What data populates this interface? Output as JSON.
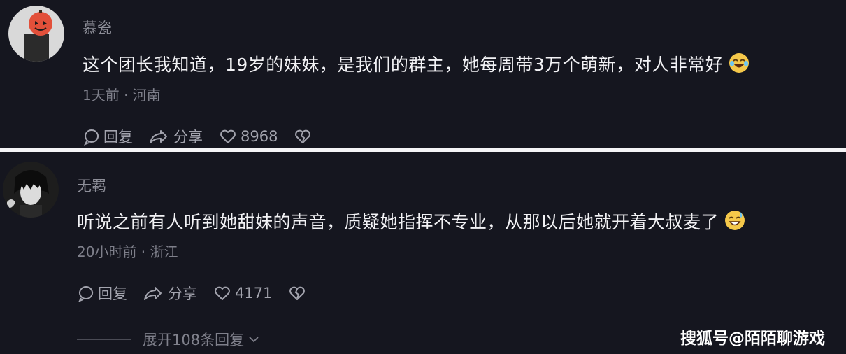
{
  "comments": [
    {
      "username": "慕瓷",
      "text": "这个团长我知道，19岁的妹妹，是我们的群主，她每周带3万个萌新，对人非常好",
      "emoji": "laughing-tears-emoji",
      "meta": "1天前 · 河南",
      "reply_label": "回复",
      "share_label": "分享",
      "likes": "8968"
    },
    {
      "username": "无羁",
      "text": "听说之前有人听到她甜妹的声音，质疑她指挥不专业，从那以后她就开着大叔麦了",
      "emoji": "sweat-smile-emoji",
      "meta": "20小时前 · 浙江",
      "reply_label": "回复",
      "share_label": "分享",
      "likes": "4171"
    }
  ],
  "expand_replies": "展开108条回复",
  "watermark": "搜狐号@陌陌聊游戏",
  "colors": {
    "background": "#15161f",
    "divider": "#f4f4f6",
    "text": "#f2f2f5",
    "muted": "#7f808b"
  }
}
